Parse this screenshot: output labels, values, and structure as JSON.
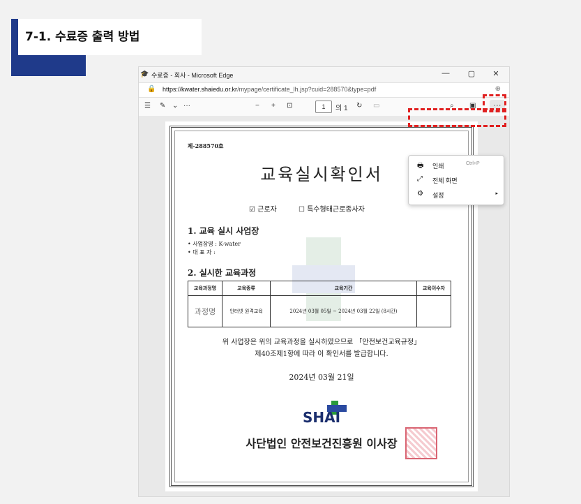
{
  "section": {
    "title": "7-1. 수료증 출력 방법"
  },
  "browser": {
    "window_title": "수료증 - 회사 - Microsoft Edge",
    "controls": {
      "minimize": "—",
      "maximize": "▢",
      "close": "✕"
    },
    "url_host": "https://kwater.shaiedu.or.kr",
    "url_path": "/mypage/certificate_lh.jsp?cuid=288570&type=pdf"
  },
  "pdf_toolbar": {
    "page_number": "1",
    "page_total": "의 1",
    "more_label": "···"
  },
  "menu": {
    "items": [
      {
        "label": "인쇄",
        "shortcut": "Ctrl+P",
        "icon": "printer-icon"
      },
      {
        "label": "전체 화면",
        "icon": "fullscreen-icon"
      },
      {
        "label": "설정",
        "icon": "settings-icon"
      }
    ]
  },
  "certificate": {
    "number": "제-288570호",
    "title": "교육실시확인서",
    "check_worker": "☑ 근로자",
    "check_special": "☐ 특수형태근로종사자",
    "section1": "1. 교육 실시 사업장",
    "company_line": "• 사업장명 : K-water",
    "rep_line": "• 대 표 자 :",
    "section2": "2. 실시한 교육과정",
    "table": {
      "headers": [
        "교육과정명",
        "교육종류",
        "교육기간",
        "교육이수자"
      ],
      "row": [
        "과정명",
        "인터넷 원격교육",
        "2024년 03월 05일 ~ 2024년 03월 22일 (8시간)",
        ""
      ]
    },
    "statement_line1": "위 사업장은 위의 교육과정을 실시하였으므로 「안전보건교육규정」",
    "statement_line2": "제40조제1항에 따라 이 확인서를 발급합니다.",
    "issue_date": "2024년 03월 21일",
    "logo_text": "SHAI",
    "issuer": "사단법인 안전보건진흥원 이사장"
  },
  "colors": {
    "accent": "#1f3a8a",
    "highlight": "#e02020",
    "seal": "#d34a5a"
  }
}
